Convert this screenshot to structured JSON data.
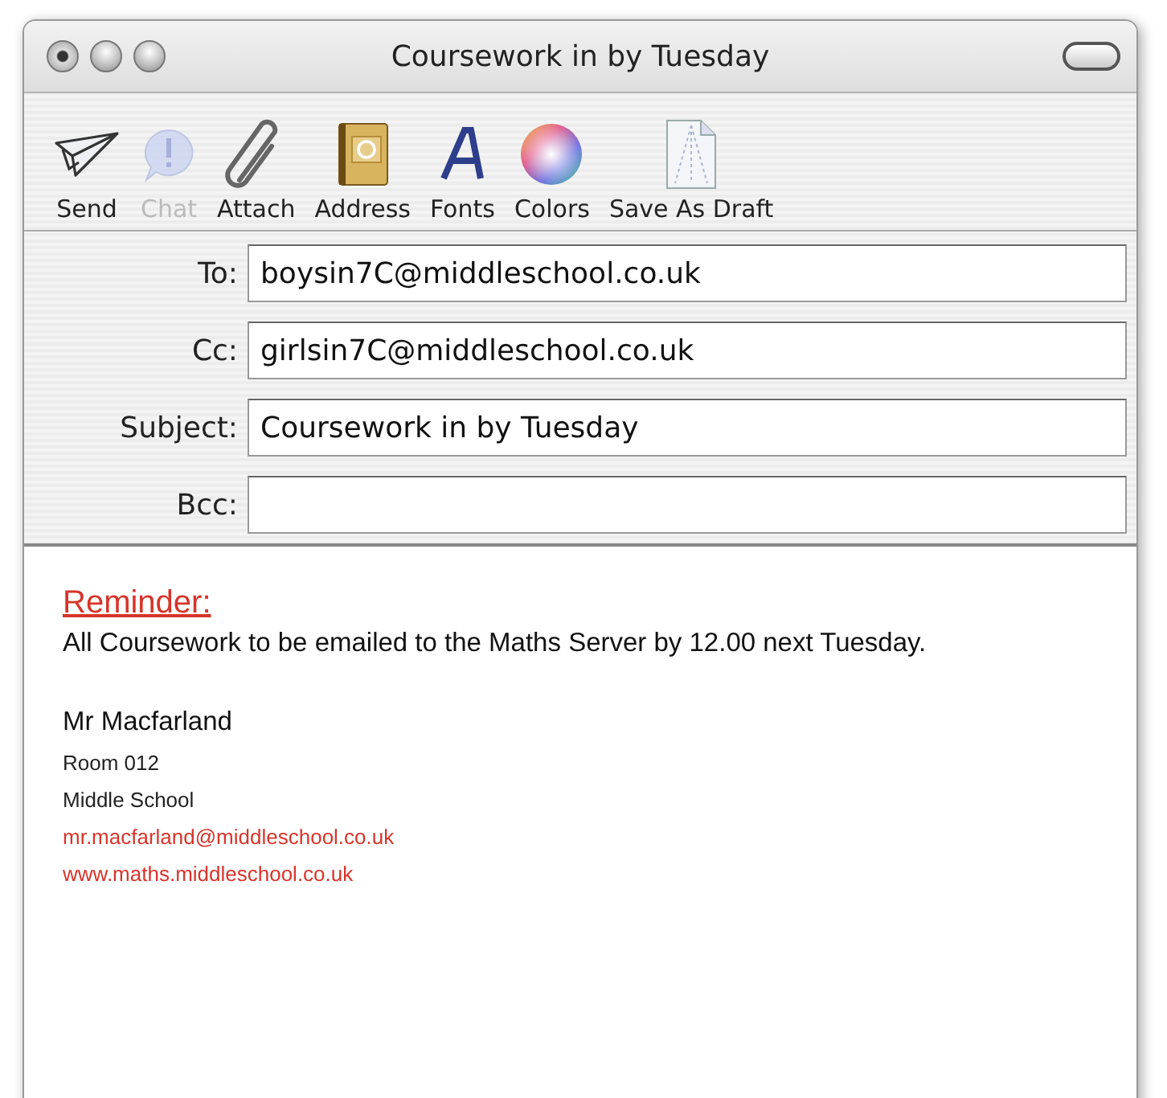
{
  "window": {
    "title": "Coursework in by Tuesday"
  },
  "toolbar": [
    {
      "label": "Send",
      "kind": "send",
      "disabled": false
    },
    {
      "label": "Chat",
      "kind": "chat",
      "disabled": true
    },
    {
      "label": "Attach",
      "kind": "attach",
      "disabled": false
    },
    {
      "label": "Address",
      "kind": "address",
      "disabled": false
    },
    {
      "label": "Fonts",
      "kind": "fonts",
      "disabled": false
    },
    {
      "label": "Colors",
      "kind": "colors",
      "disabled": false
    },
    {
      "label": "Save As Draft",
      "kind": "draft",
      "disabled": false
    }
  ],
  "fields": [
    {
      "label": "To:",
      "value": "boysin7C@middleschool.co.uk"
    },
    {
      "label": "Cc:",
      "value": "girlsin7C@middleschool.co.uk"
    },
    {
      "label": "Subject:",
      "value": "Coursework in by Tuesday"
    },
    {
      "label": "Bcc:"
    }
  ],
  "body": [
    {
      "kind": "heading",
      "text": "Reminder:"
    },
    {
      "kind": "text",
      "text": "All Coursework to be emailed to the Maths Server by 12.00 next Tuesday."
    },
    {
      "kind": "gap"
    },
    {
      "kind": "text",
      "text": "Mr Macfarland"
    },
    {
      "kind": "small",
      "text": "Room 012"
    },
    {
      "kind": "small",
      "text": "Middle School"
    },
    {
      "kind": "link",
      "text": "mr.macfarland@middleschool.co.uk"
    },
    {
      "kind": "link",
      "text": "www.maths.middleschool.co.uk"
    }
  ]
}
